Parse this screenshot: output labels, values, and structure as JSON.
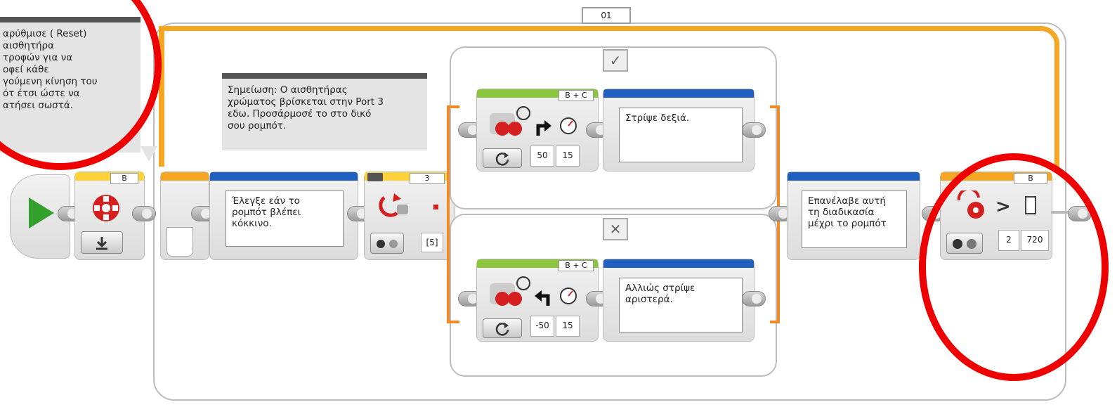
{
  "loop": {
    "label": "01"
  },
  "reset_comment": {
    "lines": [
      "Επαναρύθμισε ( Reset)",
      "τον αισθητήρα",
      "περιστροφών για να",
      "αποκοφεί κάθε",
      "προηγούμενη κίνηση του",
      "ρομπότ έτσι ώστε να",
      "λειτουργήσει σωστά."
    ],
    "visible_lines": [
      "αρύθμισε ( Reset)",
      "αισθητήρα",
      "τροφών για να",
      "οφεί κάθε",
      "γούμενη κίνηση του",
      "ότ έτσι ώστε να",
      "ατήσει σωστά."
    ]
  },
  "note_comment": {
    "lines": [
      "Σημείωση: Ο αισθητήρας",
      "χρώματος βρίσκεται στην Port 3",
      "εδω. Προσάρμοσέ το στο δικό",
      "σου ρομπότ."
    ]
  },
  "reset_block": {
    "port": "B"
  },
  "check_comment": {
    "lines": [
      "Έλεγξε εάν το",
      "ρομπότ βλέπει",
      "κόκκινο."
    ]
  },
  "color_switch": {
    "port": "3",
    "value": "[5]"
  },
  "true_case": {
    "tab_symbol": "✓",
    "motor": {
      "ports": "B + C",
      "steering": "50",
      "power": "15"
    },
    "comment": {
      "lines": [
        "Στρίψε δεξιά."
      ]
    }
  },
  "false_case": {
    "tab_symbol": "✕",
    "motor": {
      "ports": "B + C",
      "steering": "-50",
      "power": "15"
    },
    "comment": {
      "lines": [
        "Αλλιώς στρίψε",
        "αριστερά."
      ]
    }
  },
  "repeat_comment": {
    "lines": [
      "Επανέλαβε αυτή",
      "τη διαδικασία",
      "μέχρι το ρομπότ"
    ]
  },
  "loop_exit": {
    "port": "B",
    "compare": "2",
    "threshold": "720",
    "operator": ">"
  },
  "colors": {
    "loop": "#f5a623",
    "comment_bar": "#1f5fbf",
    "motor_bar": "#8cc63f",
    "highlight": "#e00000"
  }
}
